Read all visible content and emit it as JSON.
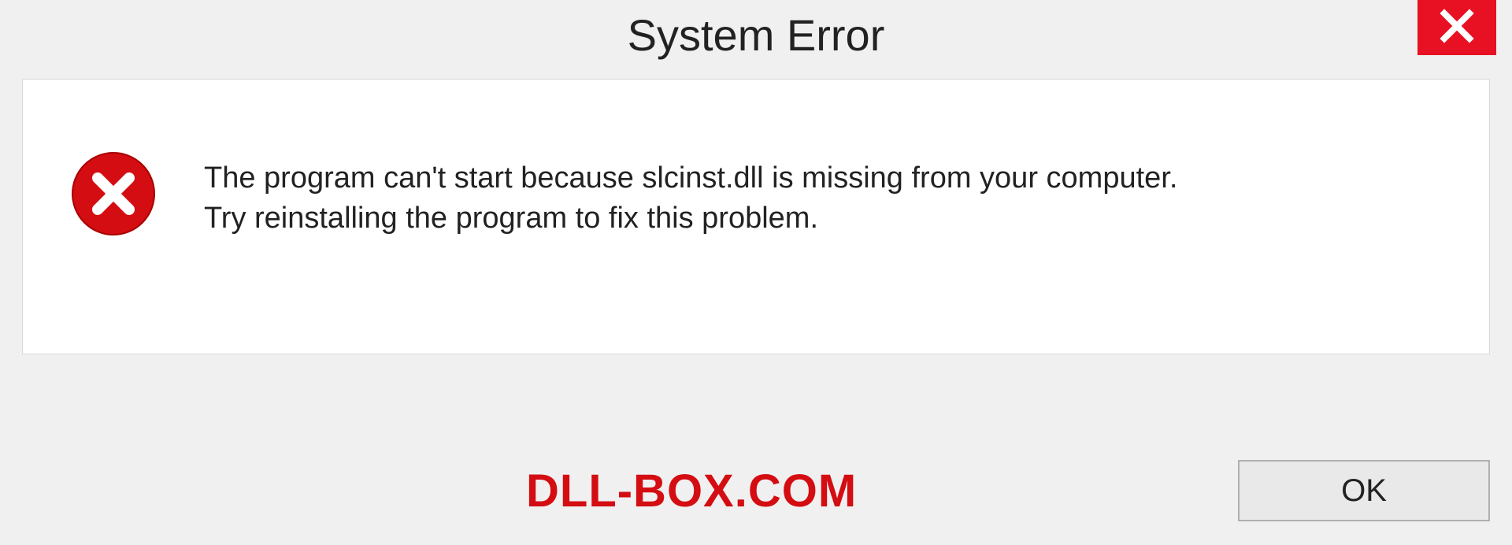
{
  "titlebar": {
    "title": "System Error"
  },
  "icons": {
    "close": "close-icon",
    "error": "error-circle-x-icon"
  },
  "message": {
    "line1": "The program can't start because slcinst.dll is missing from your computer.",
    "line2": "Try reinstalling the program to fix this problem."
  },
  "watermark": {
    "text": "DLL-BOX.COM"
  },
  "buttons": {
    "ok_label": "OK"
  },
  "colors": {
    "close_bg": "#e81123",
    "error_icon": "#d40d12",
    "watermark": "#d40d12",
    "panel_bg": "#ffffff",
    "window_bg": "#f0f0f0"
  }
}
